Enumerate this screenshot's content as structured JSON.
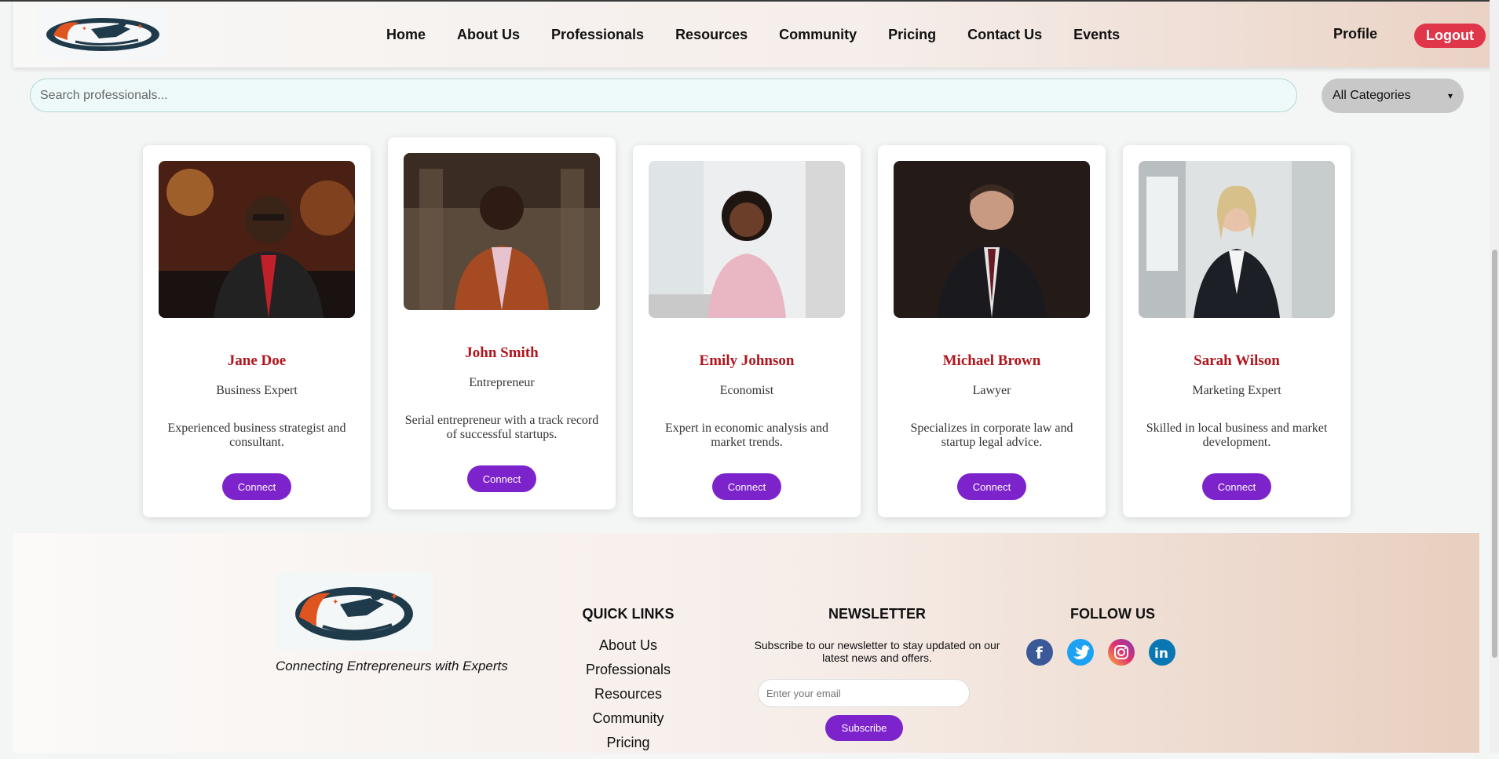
{
  "header": {
    "logo_icon": "runner-rocket-logo",
    "nav": [
      "Home",
      "About Us",
      "Professionals",
      "Resources",
      "Community",
      "Pricing",
      "Contact Us",
      "Events"
    ],
    "profile_label": "Profile",
    "logout_label": "Logout"
  },
  "search": {
    "placeholder": "Search professionals...",
    "category_selected": "All Categories"
  },
  "professionals": [
    {
      "name": "Jane Doe",
      "role": "Business Expert",
      "description": "Experienced business strategist and consultant.",
      "button": "Connect"
    },
    {
      "name": "John Smith",
      "role": "Entrepreneur",
      "description": "Serial entrepreneur with a track record of successful startups.",
      "button": "Connect"
    },
    {
      "name": "Emily Johnson",
      "role": "Economist",
      "description": "Expert in economic analysis and market trends.",
      "button": "Connect"
    },
    {
      "name": "Michael Brown",
      "role": "Lawyer",
      "description": "Specializes in corporate law and startup legal advice.",
      "button": "Connect"
    },
    {
      "name": "Sarah Wilson",
      "role": "Marketing Expert",
      "description": "Skilled in local business and market development.",
      "button": "Connect"
    }
  ],
  "footer": {
    "tagline": "Connecting Entrepreneurs with Experts",
    "quick_links_title": "QUICK LINKS",
    "quick_links": [
      "About Us",
      "Professionals",
      "Resources",
      "Community",
      "Pricing"
    ],
    "newsletter_title": "NEWSLETTER",
    "newsletter_text": "Subscribe to our newsletter to stay updated on our latest news and offers.",
    "email_placeholder": "Enter your email",
    "subscribe_label": "Subscribe",
    "follow_title": "FOLLOW US",
    "social": [
      "facebook-icon",
      "twitter-icon",
      "instagram-icon",
      "linkedin-icon"
    ]
  },
  "colors": {
    "accent_purple": "#7d23cc",
    "name_red": "#b0151c",
    "logout_red": "#e0364a"
  }
}
